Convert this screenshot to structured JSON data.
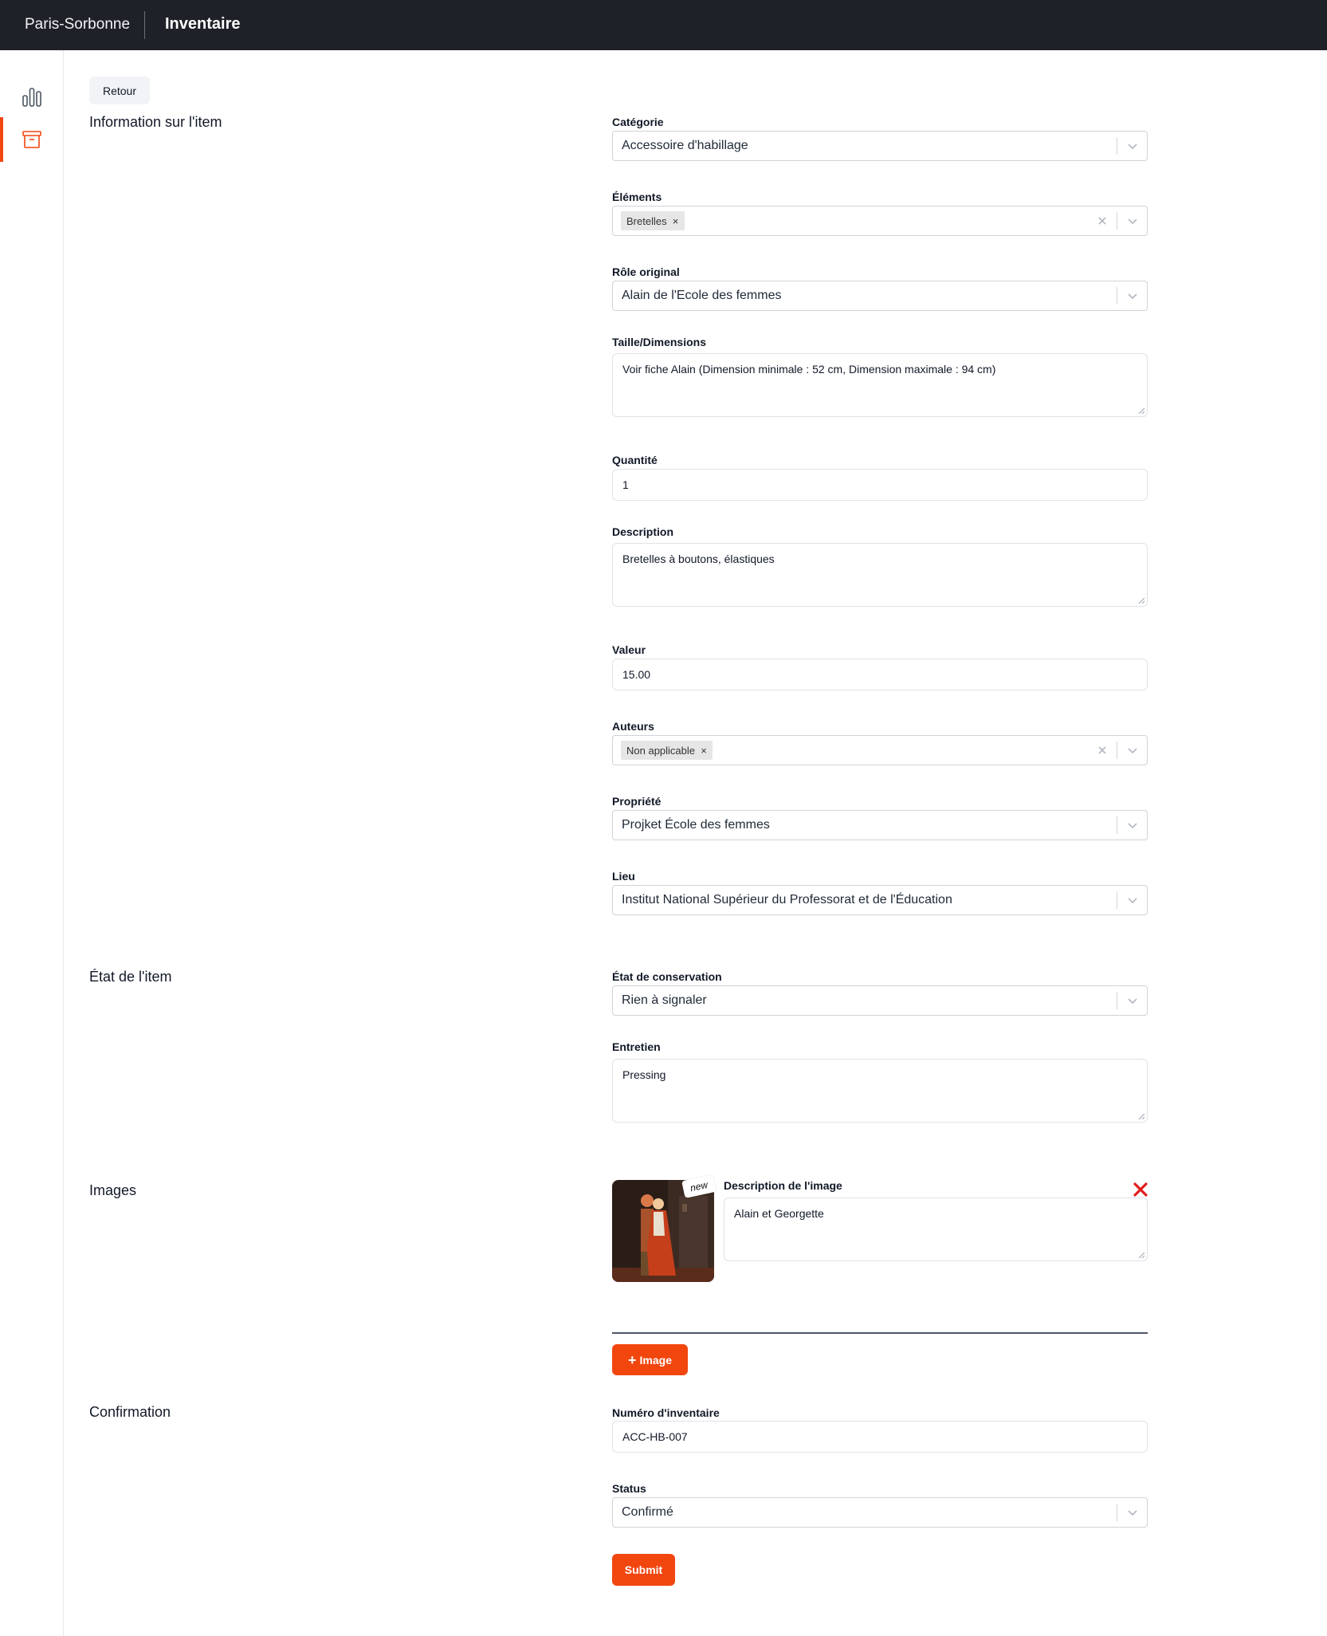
{
  "header": {
    "brand": "Paris-Sorbonne",
    "title": "Inventaire"
  },
  "sidebar": {
    "items": [
      {
        "name": "chart-bar-icon",
        "active": false
      },
      {
        "name": "archive-box-icon",
        "active": true
      }
    ]
  },
  "back_button": "Retour",
  "sections": {
    "info": "Information sur l'item",
    "state": "État de l'item",
    "images": "Images",
    "confirmation": "Confirmation"
  },
  "fields": {
    "categorie": {
      "label": "Catégorie",
      "value": "Accessoire d'habillage"
    },
    "elements": {
      "label": "Éléments",
      "chips": [
        "Bretelles"
      ]
    },
    "role": {
      "label": "Rôle original",
      "value": "Alain de l'Ecole des femmes"
    },
    "taille": {
      "label": "Taille/Dimensions",
      "value": "Voir fiche Alain (Dimension minimale : 52 cm, Dimension maximale : 94 cm)"
    },
    "quantite": {
      "label": "Quantité",
      "value": "1"
    },
    "description": {
      "label": "Description",
      "value": "Bretelles à boutons, élastiques"
    },
    "valeur": {
      "label": "Valeur",
      "value": "15.00"
    },
    "auteurs": {
      "label": "Auteurs",
      "chips": [
        "Non applicable"
      ]
    },
    "propriete": {
      "label": "Propriété",
      "value": "Projket École des femmes"
    },
    "lieu": {
      "label": "Lieu",
      "value": "Institut National Supérieur du Professorat et de l'Éducation"
    },
    "etat": {
      "label": "État de conservation",
      "value": "Rien à signaler"
    },
    "entretien": {
      "label": "Entretien",
      "value": "Pressing"
    },
    "image_desc": {
      "label": "Description de l'image",
      "value": "Alain et Georgette",
      "badge": "new"
    },
    "numero": {
      "label": "Numéro d'inventaire",
      "value": "ACC-HB-007"
    },
    "status": {
      "label": "Status",
      "value": "Confirmé"
    }
  },
  "buttons": {
    "add_image": "Image",
    "submit": "Submit"
  },
  "colors": {
    "accent": "#f2460f",
    "topbar": "#1f2128",
    "remove": "#e11d1d"
  }
}
